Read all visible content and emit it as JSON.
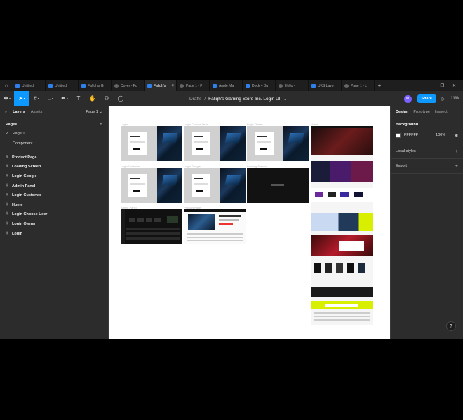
{
  "tabs": [
    {
      "label": "Untitled",
      "icon": "figma-file-icon",
      "active": false
    },
    {
      "label": "Untitled",
      "icon": "figma-file-icon",
      "active": false
    },
    {
      "label": "Falïqh's G",
      "icon": "figma-file-icon",
      "active": false
    },
    {
      "label": "Cover - Fo",
      "icon": "community-file-icon",
      "active": false
    },
    {
      "label": "Faliqh's",
      "icon": "figma-file-icon",
      "active": true
    },
    {
      "label": "Page 1 - F",
      "icon": "community-file-icon",
      "active": false
    },
    {
      "label": "Apple Ma",
      "icon": "figma-file-icon",
      "active": false
    },
    {
      "label": "Dock + Bu",
      "icon": "figma-file-icon",
      "active": false
    },
    {
      "label": "Hello -",
      "icon": "community-file-icon",
      "active": false
    },
    {
      "label": "UKS Layo",
      "icon": "figma-file-icon",
      "active": false
    },
    {
      "label": "Page 1 - L",
      "icon": "community-file-icon",
      "active": false
    }
  ],
  "tab_close": "×",
  "tab_plus": "+",
  "toolbar": {
    "breadcrumb_root": "Drafts",
    "breadcrumb_sep": "/",
    "file_name": "Faliqh's Gaming Store Inc. Login UI",
    "file_chevron": "⌄",
    "avatar_initial": "M",
    "share_label": "Share",
    "zoom": "11%"
  },
  "left_panel": {
    "tab_layers": "Layers",
    "tab_assets": "Assets",
    "current_page": "Page 1",
    "pages_header": "Pages",
    "pages": [
      {
        "label": "Page 1",
        "selected": true
      },
      {
        "label": "Component",
        "selected": false
      }
    ],
    "layers": [
      "Product Page",
      "Loading Screen",
      "Login Google",
      "Admin Panel",
      "Login Customer",
      "Home",
      "Login Choose User",
      "Login Owner",
      "Login"
    ]
  },
  "canvas": {
    "frames": [
      {
        "label": "Login"
      },
      {
        "label": "Login Choose User"
      },
      {
        "label": "Login Owner"
      },
      {
        "label": "Login Customer"
      },
      {
        "label": "Login Google"
      },
      {
        "label": "Loading Screen"
      },
      {
        "label": "Admin Panel"
      },
      {
        "label": "Product Page"
      },
      {
        "label": "Home"
      }
    ]
  },
  "right_panel": {
    "tab_design": "Design",
    "tab_prototype": "Prototype",
    "tab_inspect": "Inspect",
    "background_title": "Background",
    "background_hex": "FFFFFF",
    "background_opacity": "100%",
    "local_styles": "Local styles",
    "export": "Export"
  },
  "help_label": "?",
  "colors": {
    "accent": "#0d99ff",
    "panel": "#2c2c2c",
    "tabbar": "#1e1e1e",
    "canvas": "#ffffff"
  }
}
